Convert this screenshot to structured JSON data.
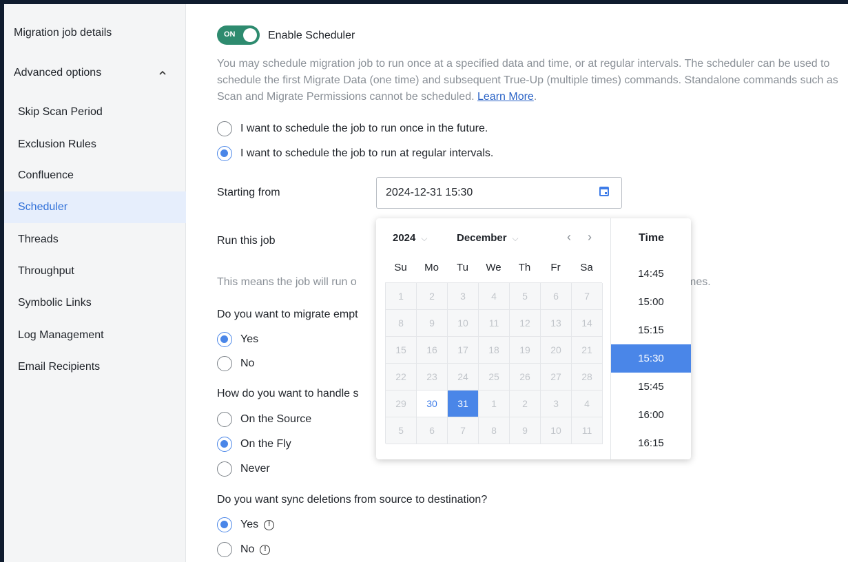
{
  "sidebar": {
    "items": [
      {
        "label": "Migration job details"
      },
      {
        "label": "Advanced options"
      },
      {
        "label": "Skip Scan Period"
      },
      {
        "label": "Exclusion Rules"
      },
      {
        "label": "Confluence"
      },
      {
        "label": "Scheduler"
      },
      {
        "label": "Threads"
      },
      {
        "label": "Throughput"
      },
      {
        "label": "Symbolic Links"
      },
      {
        "label": "Log Management"
      },
      {
        "label": "Email Recipients"
      }
    ],
    "active": "Scheduler",
    "chevron_icon": "chevron-up-icon"
  },
  "scheduler": {
    "toggle_label": "ON",
    "enable_label": "Enable Scheduler",
    "description": "You may schedule migration job to run once at a specified data and time, or at regular intervals. The scheduler can be used to schedule the first Migrate Data (one time) and subsequent True-Up (multiple times) commands. Standalone commands such as Scan and Migrate Permissions cannot be scheduled.",
    "learn_more": "Learn More",
    "period": ".",
    "options": [
      {
        "label": "I want to schedule the job to run once in the future.",
        "checked": false
      },
      {
        "label": "I want to schedule the job to run at regular intervals.",
        "checked": true
      }
    ],
    "starting_from_label": "Starting from",
    "starting_from_value": "2024-12-31 15:30",
    "run_label": "Run this job",
    "means_text_left": "This means the job will run o",
    "means_text_right": "mes."
  },
  "q_empty": {
    "question": "Do you want to migrate empt",
    "options": [
      {
        "label": "Yes",
        "checked": true
      },
      {
        "label": "No",
        "checked": false
      }
    ]
  },
  "q_handle": {
    "question": "How do you want to handle s",
    "options": [
      {
        "label": "On the Source",
        "checked": false
      },
      {
        "label": "On the Fly",
        "checked": true
      },
      {
        "label": "Never",
        "checked": false
      }
    ]
  },
  "q_sync": {
    "question": "Do you want sync deletions from source to destination?",
    "options": [
      {
        "label": "Yes",
        "checked": true
      },
      {
        "label": "No",
        "checked": false
      }
    ],
    "info_symbol": "!"
  },
  "picker": {
    "year": "2024",
    "month": "December",
    "prev": "‹",
    "next": "›",
    "caret": "⌵",
    "weekdays": [
      "Su",
      "Mo",
      "Tu",
      "We",
      "Th",
      "Fr",
      "Sa"
    ],
    "weeks": [
      [
        "1",
        "2",
        "3",
        "4",
        "5",
        "6",
        "7"
      ],
      [
        "8",
        "9",
        "10",
        "11",
        "12",
        "13",
        "14"
      ],
      [
        "15",
        "16",
        "17",
        "18",
        "19",
        "20",
        "21"
      ],
      [
        "22",
        "23",
        "24",
        "25",
        "26",
        "27",
        "28"
      ],
      [
        "29",
        "30",
        "31",
        "1",
        "2",
        "3",
        "4"
      ],
      [
        "5",
        "6",
        "7",
        "8",
        "9",
        "10",
        "11"
      ]
    ],
    "enabled_days": [
      "30",
      "31"
    ],
    "today": "30",
    "selected": "31",
    "time_header": "Time",
    "times": [
      "14:45",
      "15:00",
      "15:15",
      "15:30",
      "15:45",
      "16:00",
      "16:15"
    ],
    "selected_time": "15:30"
  },
  "colors": {
    "accent": "#4a86e8",
    "toggle": "#2e8b6f",
    "link": "#2b63c6"
  }
}
